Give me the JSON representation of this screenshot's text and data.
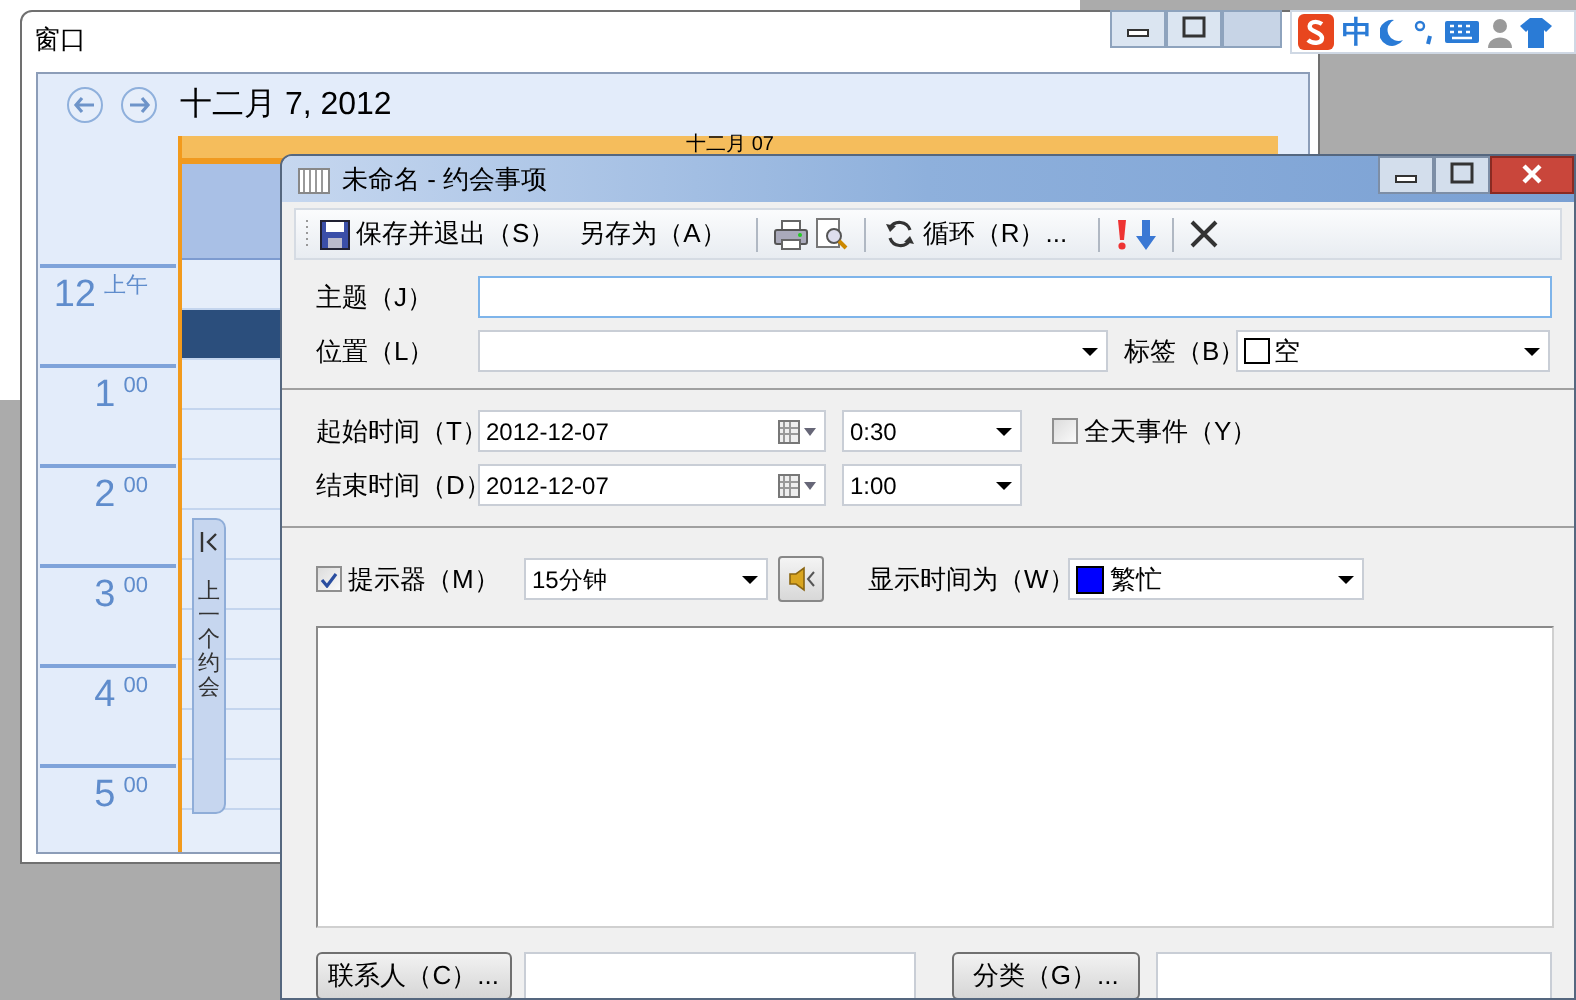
{
  "ime_bar": {
    "mode": "中"
  },
  "calendar_window": {
    "title": "窗口",
    "date": "十二月 7, 2012",
    "day_header": "十二月 07",
    "hours": [
      {
        "hour": "12",
        "suffix": "上午"
      },
      {
        "hour": "1",
        "suffix": "00"
      },
      {
        "hour": "2",
        "suffix": "00"
      },
      {
        "hour": "3",
        "suffix": "00"
      },
      {
        "hour": "4",
        "suffix": "00"
      },
      {
        "hour": "5",
        "suffix": "00"
      }
    ],
    "side_tab": "上一个约会"
  },
  "dialog": {
    "title": "未命名 - 约会事项",
    "toolbar": [
      {
        "kind": "save",
        "label": "保存并退出（S）"
      },
      {
        "kind": "text",
        "label": "另存为（A）"
      },
      {
        "kind": "separator"
      },
      {
        "kind": "print"
      },
      {
        "kind": "preview"
      },
      {
        "kind": "separator"
      },
      {
        "kind": "recurrence",
        "label": "循环（R）..."
      },
      {
        "kind": "separator"
      },
      {
        "kind": "high_importance"
      },
      {
        "kind": "low_importance"
      },
      {
        "kind": "separator"
      },
      {
        "kind": "delete"
      }
    ],
    "subject": {
      "label": "主题（J）"
    },
    "location": {
      "label": "位置（L）"
    },
    "tag": {
      "label": "标签（B）",
      "value": "空",
      "color": "#ffffff"
    },
    "start": {
      "label": "起始时间（T）",
      "date": "2012-12-07",
      "time": "0:30"
    },
    "end": {
      "label": "结束时间（D）",
      "date": "2012-12-07",
      "time": "1:00"
    },
    "all_day": {
      "label": "全天事件（Y）",
      "checked": false
    },
    "reminder": {
      "label": "提示器（M）",
      "checked": true,
      "value": "15分钟"
    },
    "show_as": {
      "label": "显示时间为（W）",
      "value": "繁忙",
      "color": "#0000ff"
    },
    "contacts_button": "联系人（C）...",
    "categories_button": "分类（G）..."
  }
}
